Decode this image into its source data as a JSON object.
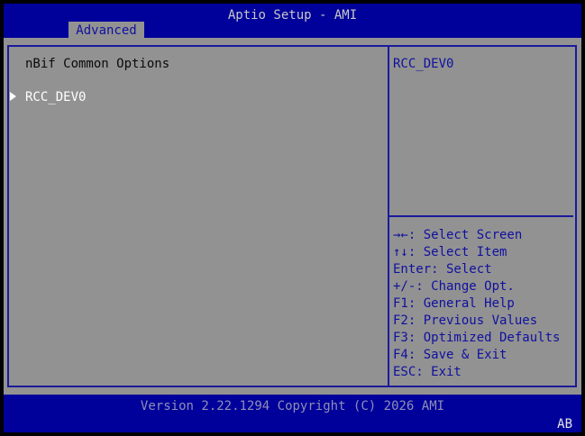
{
  "header": {
    "title": "Aptio Setup - AMI",
    "active_tab": "Advanced"
  },
  "main": {
    "section_title": "nBif Common Options",
    "items": [
      {
        "label": "RCC_DEV0",
        "selected": true
      }
    ]
  },
  "help": {
    "description": "RCC_DEV0",
    "keys": [
      {
        "text": "→←: Select Screen"
      },
      {
        "text": "↑↓: Select Item"
      },
      {
        "text": "Enter: Select"
      },
      {
        "text": "+/-: Change Opt."
      },
      {
        "text": "F1: General Help"
      },
      {
        "text": "F2: Previous Values"
      },
      {
        "text": "F3: Optimized Defaults"
      },
      {
        "text": "F4: Save & Exit"
      },
      {
        "text": "ESC: Exit"
      }
    ]
  },
  "footer": {
    "version": "Version 2.22.1294 Copyright (C) 2026 AMI",
    "badge": "AB"
  },
  "colors": {
    "header_blue": "#00009b",
    "panel_grey": "#929292",
    "border_blue": "#1a1a9c",
    "help_text_blue": "#1010a0"
  }
}
